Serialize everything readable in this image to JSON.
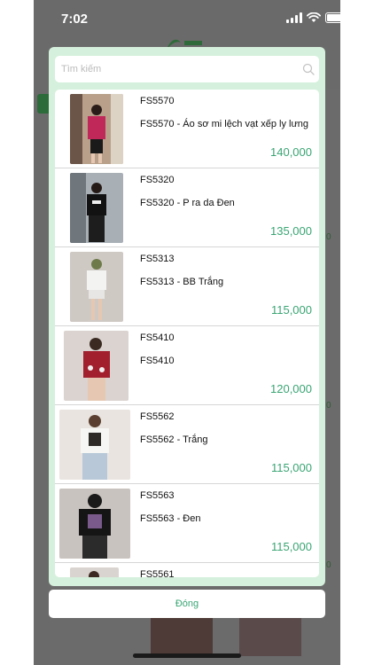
{
  "status_bar": {
    "time": "7:02"
  },
  "search": {
    "placeholder": "Tìm kiếm",
    "value": ""
  },
  "products": [
    {
      "code": "FS5570",
      "name": "FS5570 - Áo sơ mi lệch vạt xếp ly lưng",
      "price": "140,000"
    },
    {
      "code": "FS5320",
      "name": "FS5320 - P ra da Đen",
      "price": "135,000"
    },
    {
      "code": "FS5313",
      "name": "FS5313 - BB Trắng",
      "price": "115,000"
    },
    {
      "code": "FS5410",
      "name": "FS5410",
      "price": "120,000"
    },
    {
      "code": "FS5562",
      "name": "FS5562 - Trắng",
      "price": "115,000"
    },
    {
      "code": "FS5563",
      "name": "FS5563 - Đen",
      "price": "115,000"
    },
    {
      "code": "FS5561",
      "name": "",
      "price": ""
    }
  ],
  "close_label": "Đóng",
  "colors": {
    "accent": "#3aa574",
    "modal_bg": "#d5f0dc",
    "overlay": "#6b6b6b"
  }
}
